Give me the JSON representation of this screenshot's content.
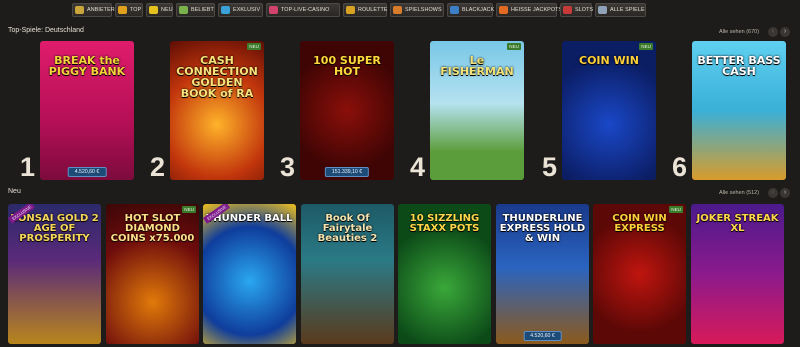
{
  "nav": [
    {
      "label": "Anbieter",
      "icon": "gift-icon",
      "color": "#c9a53a"
    },
    {
      "label": "Top",
      "icon": "crown-icon",
      "color": "#e0a11c"
    },
    {
      "label": "Neu",
      "icon": "lightning-icon",
      "color": "#e6c21f"
    },
    {
      "label": "Beliebt",
      "icon": "slot-machine-icon",
      "color": "#7ab14b"
    },
    {
      "label": "Exklusiv",
      "icon": "diamond-icon",
      "color": "#3aa2d8"
    },
    {
      "label": "Top-Live-Casino",
      "icon": "live-dealer-icon",
      "color": "#d1436c"
    },
    {
      "label": "Roulette",
      "icon": "roulette-icon",
      "color": "#d8a322"
    },
    {
      "label": "Spielshows",
      "icon": "microphone-icon",
      "color": "#d67c2a"
    },
    {
      "label": "Blackjack",
      "icon": "cards-icon",
      "color": "#3d7fc6"
    },
    {
      "label": "Heisse Jackpots",
      "icon": "fire-icon",
      "color": "#e36a22"
    },
    {
      "label": "Slots",
      "icon": "cherries-icon",
      "color": "#c63a3a"
    },
    {
      "label": "Alle Spiele",
      "icon": "grid-icon",
      "color": "#8fa2b8"
    }
  ],
  "top": {
    "title": "Top-Spiele: Deutschland",
    "see_all": "Alle sehen (670)",
    "tiles": [
      {
        "rank": "1",
        "title": "BREAK the PIGGY BANK",
        "jackpot": "4.520,60 €",
        "bg": "linear-gradient(#e01c6c, #b30f56 60%, #7c0b3c)",
        "color": "#f6d23a",
        "new": ""
      },
      {
        "rank": "2",
        "title": "CASH CONNECTION GOLDEN BOOK of RA",
        "jackpot": "",
        "bg": "radial-gradient(circle at 50% 60%, #ffb32a, #c2360c 55%, #5e0d05)",
        "color": "#f9e27a",
        "new": "NEU"
      },
      {
        "rank": "3",
        "title": "100 SUPER HOT",
        "jackpot": "151.339,10 €",
        "bg": "radial-gradient(circle at 50% 50%, #8b0f0a, #3f0504 70%)",
        "color": "#ffd93c",
        "new": ""
      },
      {
        "rank": "4",
        "title": "Le FISHERMAN",
        "jackpot": "",
        "bg": "linear-gradient(#78c7e6, #b6e2f0 45%, #5b9d3a 80%)",
        "color": "#f1e37a",
        "new": "NEU"
      },
      {
        "rank": "5",
        "title": "COIN WIN",
        "jackpot": "",
        "bg": "radial-gradient(circle at 50% 60%, #1a48c8, #0b1d63 70%)",
        "color": "#ffd03a",
        "new": "NEU"
      },
      {
        "rank": "6",
        "title": "BETTER BASS CASH",
        "jackpot": "",
        "bg": "linear-gradient(#5fd0f0, #3ab0d8 50%, #d89c2a)",
        "color": "#ffffff",
        "new": ""
      }
    ]
  },
  "neu": {
    "title": "Neu",
    "see_all": "Alle sehen (512)",
    "tiles": [
      {
        "title": "BONSAI GOLD 2 AGE OF PROSPERITY",
        "jackpot": "",
        "bg": "linear-gradient(#2b2a6a, #5a2a7a 40%, #b8861c)",
        "color": "#f6d75a",
        "new": "",
        "ribbon": "EXCLUSIVE"
      },
      {
        "title": "HOT SLOT DIAMOND COINS x75.000",
        "jackpot": "",
        "bg": "radial-gradient(circle at 50% 70%, #e07a0a, #6e0c0c 60%, #3b0606)",
        "color": "#ffe08a",
        "new": "NEU",
        "ribbon": ""
      },
      {
        "title": "THUNDER BALL",
        "jackpot": "",
        "bg": "radial-gradient(circle at 50% 55%, #2aa7f0, #0f3d9c 60%, #f2c21c)",
        "color": "#ffffff",
        "new": "",
        "ribbon": "EXCLUSIVE"
      },
      {
        "title": "Book Of Fairytale Beauties 2",
        "jackpot": "",
        "bg": "linear-gradient(#1d5a66, #2a7a86 40%, #5a3a1c)",
        "color": "#f3e4b0",
        "new": "",
        "ribbon": ""
      },
      {
        "title": "10 SIZZLING STAXX POTS",
        "jackpot": "",
        "bg": "radial-gradient(circle at 50% 60%, #3aa83a, #0c4a18 65%)",
        "color": "#ffd84a",
        "new": "",
        "ribbon": ""
      },
      {
        "title": "THUNDERLINE EXPRESS HOLD & WIN",
        "jackpot": "4.520,60 €",
        "bg": "linear-gradient(#1a3a8c, #2a64c0 45%, #8c5a1c)",
        "color": "#ffffff",
        "new": "",
        "ribbon": ""
      },
      {
        "title": "COIN WIN EXPRESS",
        "jackpot": "",
        "bg": "radial-gradient(circle at 50% 50%, #c0150f, #5c0806 70%)",
        "color": "#ffd03a",
        "new": "NEU",
        "ribbon": ""
      },
      {
        "title": "JOKER STREAK XL",
        "jackpot": "",
        "bg": "linear-gradient(#4b1a8c, #8c1a8c 50%, #d81a5a)",
        "color": "#ffd84a",
        "new": "",
        "ribbon": ""
      }
    ]
  }
}
